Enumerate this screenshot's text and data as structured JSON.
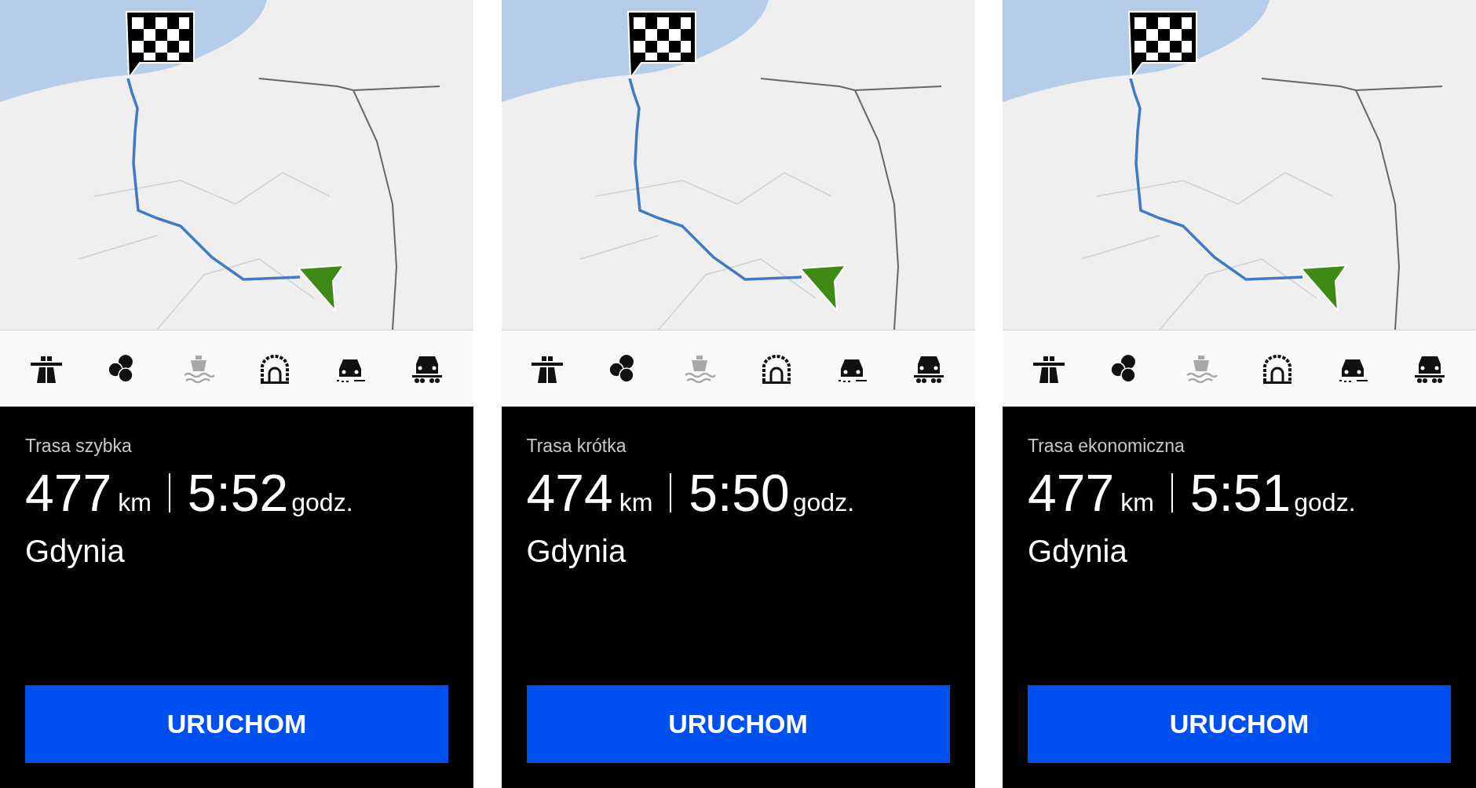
{
  "panels": [
    {
      "route_options": [
        {
          "kind": "motorway",
          "on": true
        },
        {
          "kind": "toll",
          "on": true
        },
        {
          "kind": "ferry",
          "on": false
        },
        {
          "kind": "tunnel",
          "on": true
        },
        {
          "kind": "unpaved",
          "on": true
        },
        {
          "kind": "cartrain",
          "on": true
        }
      ],
      "route_type": "Trasa szybka",
      "distance": "477",
      "distance_unit": "km",
      "time": "5:52",
      "time_unit": "godz.",
      "destination": "Gdynia",
      "button": "URUCHOM"
    },
    {
      "route_options": [
        {
          "kind": "motorway",
          "on": true
        },
        {
          "kind": "toll",
          "on": true
        },
        {
          "kind": "ferry",
          "on": false
        },
        {
          "kind": "tunnel",
          "on": true
        },
        {
          "kind": "unpaved",
          "on": true
        },
        {
          "kind": "cartrain",
          "on": true
        }
      ],
      "route_type": "Trasa krótka",
      "distance": "474",
      "distance_unit": "km",
      "time": "5:50",
      "time_unit": "godz.",
      "destination": "Gdynia",
      "button": "URUCHOM"
    },
    {
      "route_options": [
        {
          "kind": "motorway",
          "on": true
        },
        {
          "kind": "toll",
          "on": true
        },
        {
          "kind": "ferry",
          "on": false
        },
        {
          "kind": "tunnel",
          "on": true
        },
        {
          "kind": "unpaved",
          "on": true
        },
        {
          "kind": "cartrain",
          "on": true
        }
      ],
      "route_type": "Trasa ekonomiczna",
      "distance": "477",
      "distance_unit": "km",
      "time": "5:51",
      "time_unit": "godz.",
      "destination": "Gdynia",
      "button": "URUCHOM"
    }
  ]
}
